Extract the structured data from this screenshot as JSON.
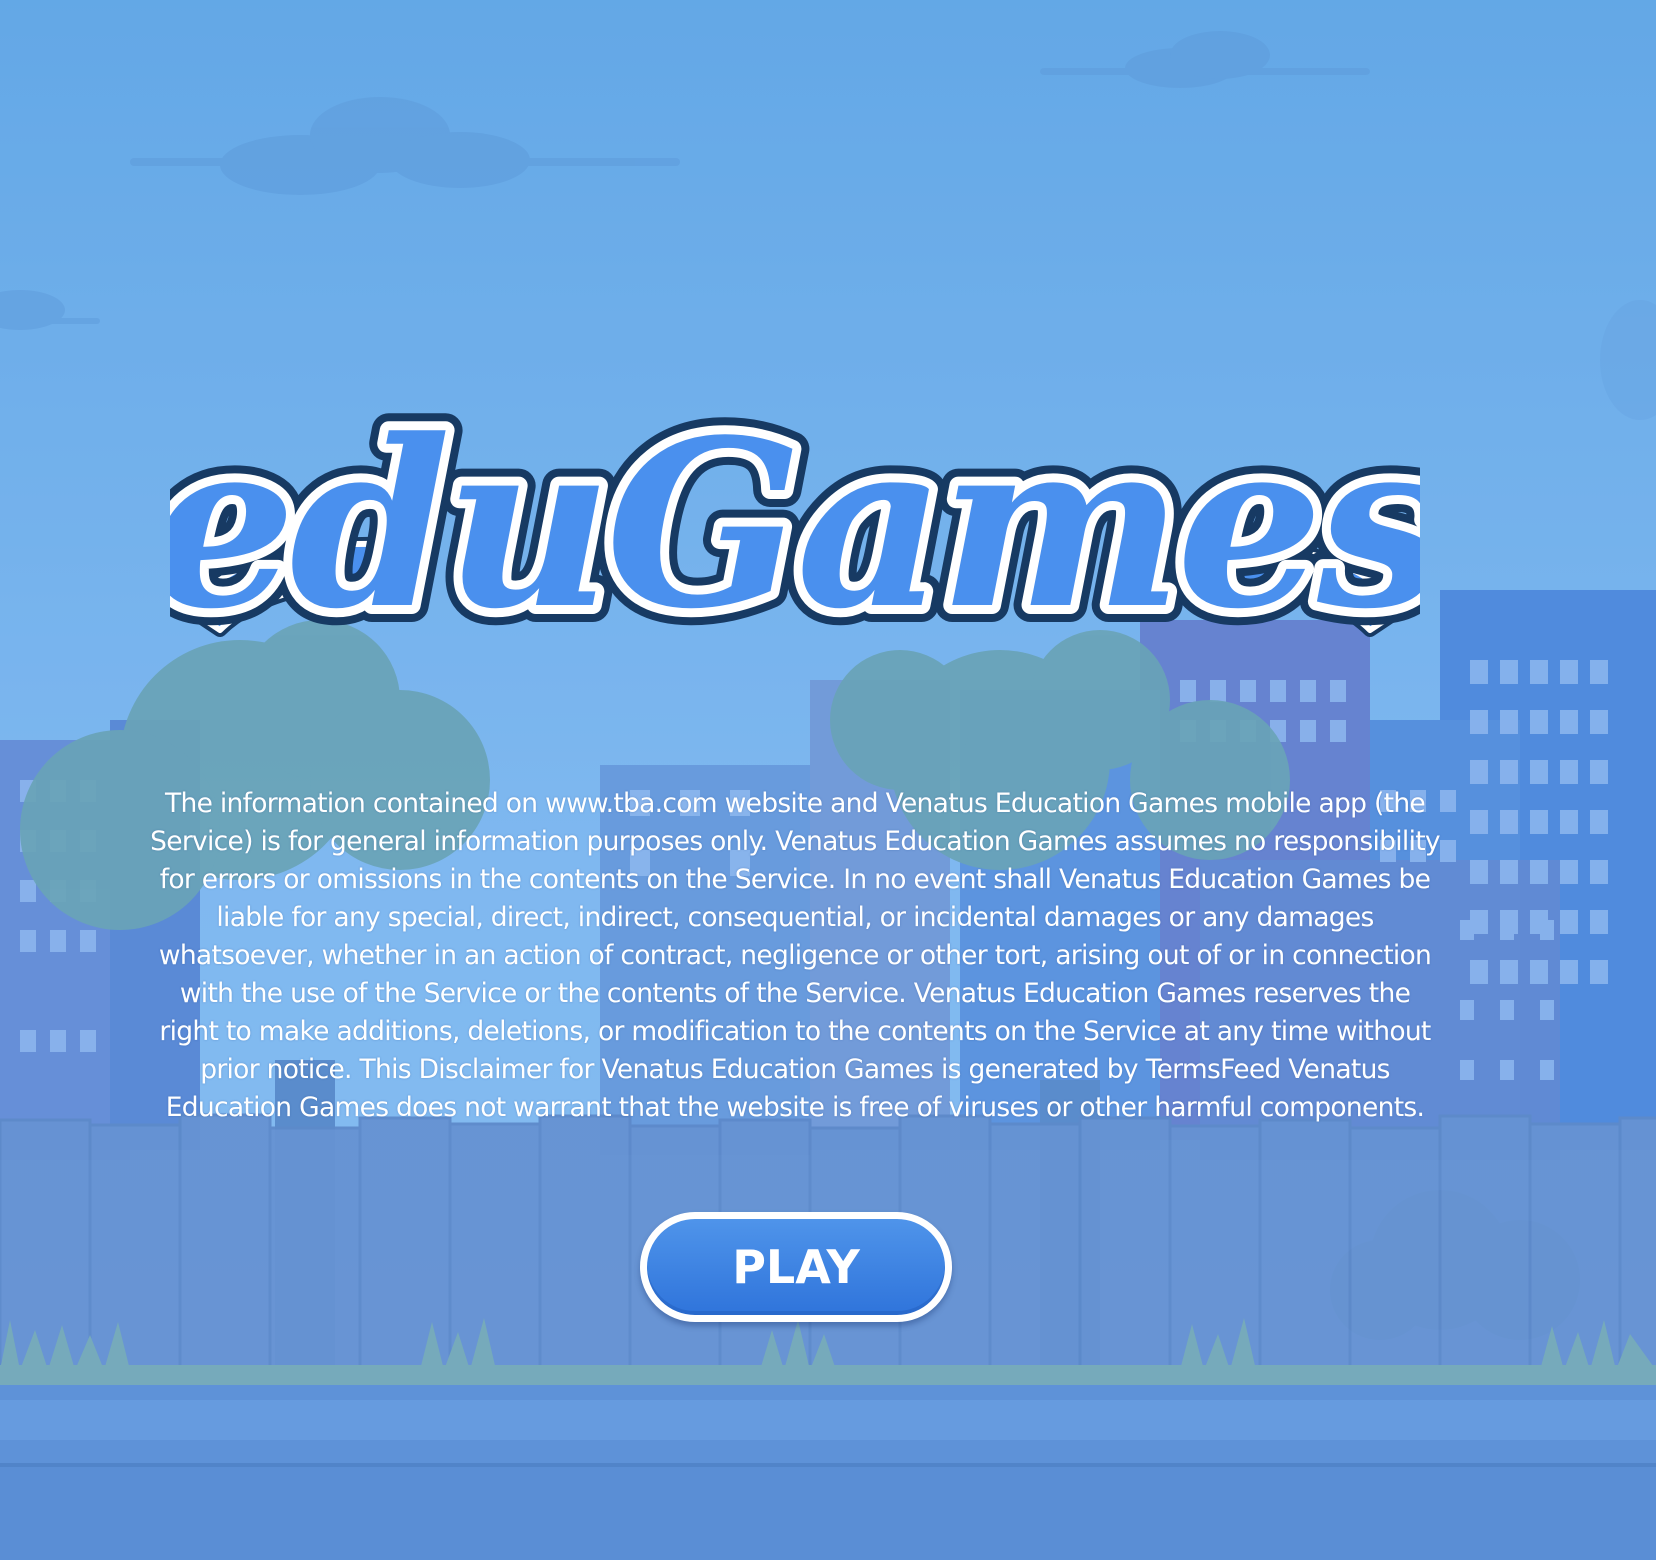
{
  "logo": {
    "text": "eduGames"
  },
  "disclaimer": {
    "text": "The information contained on www.tba.com website and Venatus Education Games mobile app (the Service) is for general information purposes only. Venatus Education Games assumes no responsibility for errors or omissions in the contents on the Service. In no event shall Venatus Education Games be liable for any special, direct, indirect, consequential, or incidental damages or any damages whatsoever, whether in an action of contract, negligence or other tort, arising out of or in connection with the use of the Service or the contents of the Service. Venatus Education Games reserves the right to make additions, deletions, or modification to the contents on the Service at any time without prior notice. This Disclaimer for Venatus Education Games is generated by TermsFeed Venatus Education Games does not warrant that the website is free of viruses or other harmful components."
  },
  "play_button": {
    "label": "PLAY"
  },
  "colors": {
    "sky": "#5ea4e3",
    "button": "#3b82e6",
    "logo_fill": "#4a90ee",
    "logo_outline": "#173a63"
  }
}
